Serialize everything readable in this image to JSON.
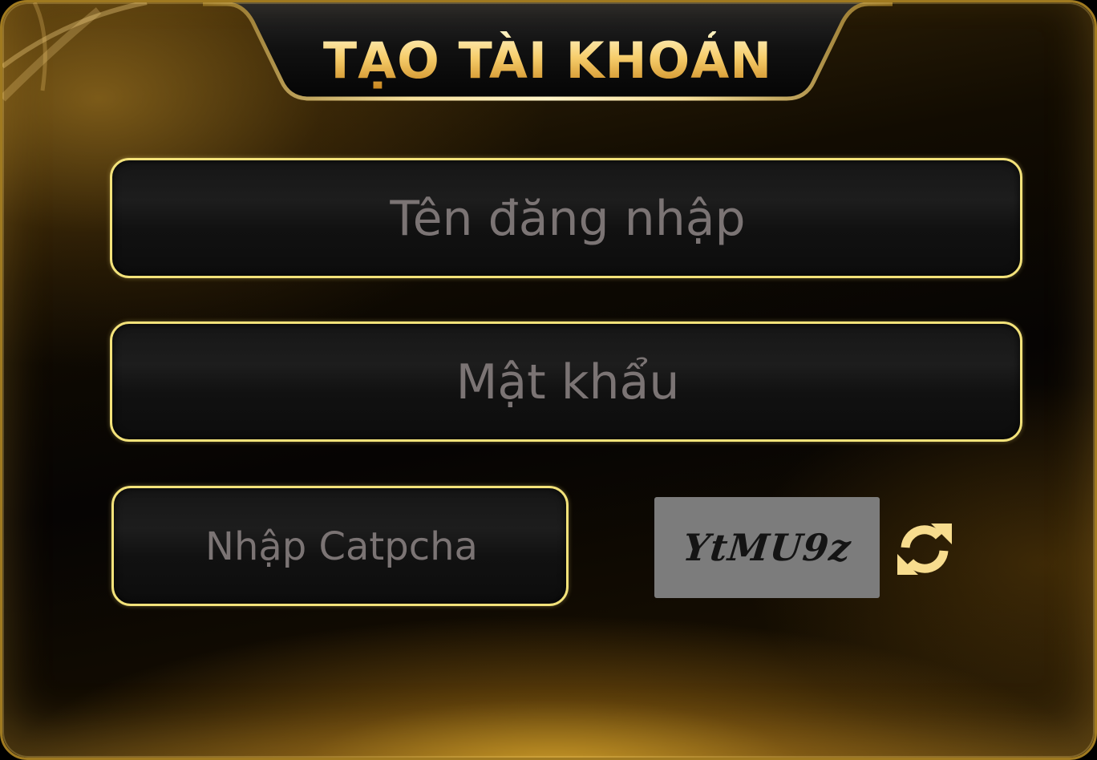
{
  "title": "TẠO TÀI KHOẢN",
  "form": {
    "username_placeholder": "Tên đăng nhập",
    "password_placeholder": "Mật khẩu",
    "captcha_placeholder": "Nhập Catpcha",
    "captcha_code": "YtMU9z"
  },
  "colors": {
    "accent_gold": "#f3e27a",
    "title_gold": "#f2c463",
    "captcha_bg": "#7c7c7c",
    "placeholder": "#7b7474"
  },
  "icons": {
    "refresh": "refresh-icon"
  }
}
